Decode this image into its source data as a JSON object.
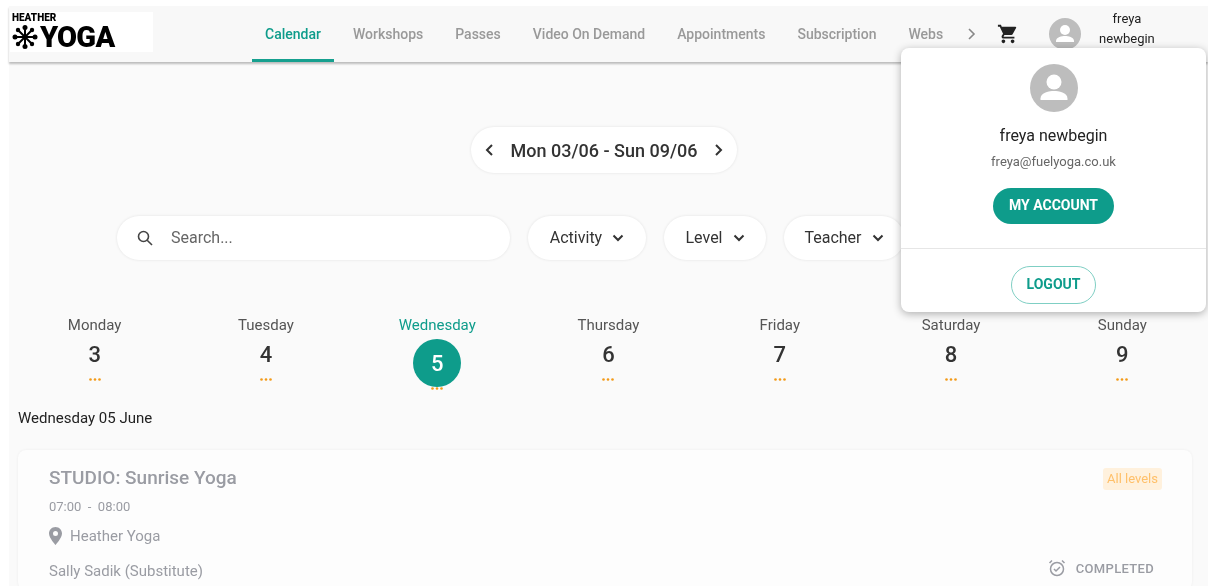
{
  "logo": {
    "small_text": "HEATHER",
    "big_text": "YOGA"
  },
  "tabs": [
    {
      "label": "Calendar",
      "selected": true
    },
    {
      "label": "Workshops",
      "selected": false
    },
    {
      "label": "Passes",
      "selected": false
    },
    {
      "label": "Video On Demand",
      "selected": false
    },
    {
      "label": "Appointments",
      "selected": false
    },
    {
      "label": "Subscription",
      "selected": false
    },
    {
      "label": "Webs",
      "selected": false
    }
  ],
  "user": {
    "first": "freya",
    "last": "newbegin"
  },
  "week_range": "Mon 03/06 - Sun 09/06",
  "search": {
    "placeholder": "Search..."
  },
  "filters": [
    "Activity",
    "Level",
    "Teacher"
  ],
  "days": [
    {
      "name": "Monday",
      "number": "3",
      "selected": false
    },
    {
      "name": "Tuesday",
      "number": "4",
      "selected": false
    },
    {
      "name": "Wednesday",
      "number": "5",
      "selected": true
    },
    {
      "name": "Thursday",
      "number": "6",
      "selected": false
    },
    {
      "name": "Friday",
      "number": "7",
      "selected": false
    },
    {
      "name": "Saturday",
      "number": "8",
      "selected": false
    },
    {
      "name": "Sunday",
      "number": "9",
      "selected": false
    }
  ],
  "day_heading": "Wednesday 05 June",
  "classes": [
    {
      "title": "STUDIO: Sunrise Yoga",
      "time": "07:00  -  08:00",
      "location": "Heather Yoga",
      "teacher": "Sally Sadik (Substitute)",
      "level": "All levels",
      "status": "COMPLETED",
      "completed": true
    }
  ],
  "account_menu": {
    "name": "freya newbegin",
    "email": "freya@fuelyoga.co.uk",
    "account_button": "MY ACCOUNT",
    "logout_button": "LOGOUT"
  }
}
